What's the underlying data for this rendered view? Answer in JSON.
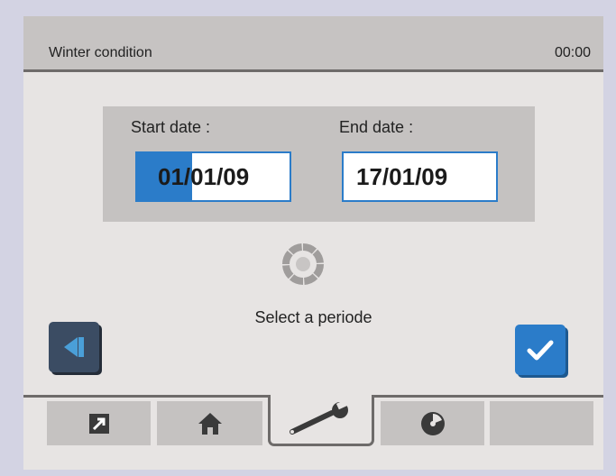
{
  "header": {
    "title": "Winter condition",
    "time": "00:00"
  },
  "period": {
    "start_label": "Start date :",
    "start_selected": "01",
    "start_rest": "/01/09",
    "end_label": "End date :",
    "end_value": "17/01/09"
  },
  "message": "Select a periode",
  "icons": {
    "back": "back-arrow-icon",
    "confirm": "checkmark-icon",
    "navigation": "navigation-ring-icon",
    "tabs": [
      "export-icon",
      "home-icon",
      "wrench-icon",
      "disc-icon",
      ""
    ]
  },
  "colors": {
    "accent": "#2b7cc9",
    "back_button": "#3b4c63"
  },
  "tabs": {
    "active_index": 2
  }
}
